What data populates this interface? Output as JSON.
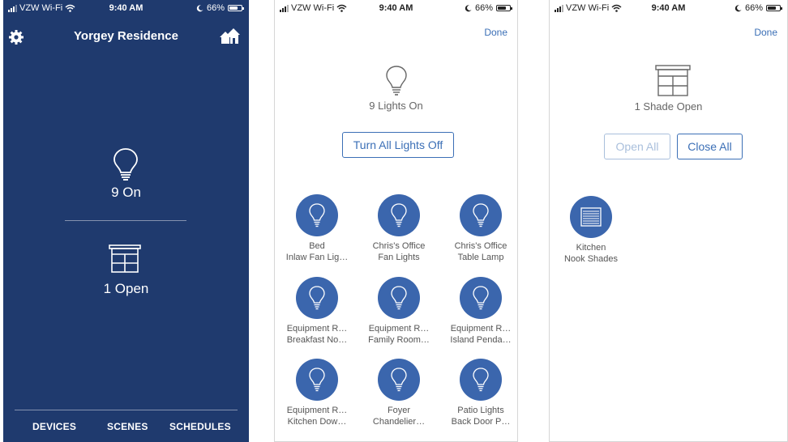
{
  "status": {
    "carrier": "VZW Wi-Fi",
    "time": "9:40 AM",
    "battery": "66%"
  },
  "home": {
    "title": "Yorgey Residence",
    "lights_summary": "9 On",
    "shades_summary": "1 Open",
    "nav": [
      "DEVICES",
      "SCENES",
      "SCHEDULES"
    ],
    "icons": {
      "settings": "gear-icon",
      "homes": "homes-icon",
      "light": "lightbulb-icon",
      "shade": "window-shade-icon"
    }
  },
  "lights": {
    "done": "Done",
    "summary": "9 Lights On",
    "turn_all_off": "Turn All Lights Off",
    "devices": [
      {
        "line1": "Bed",
        "line2": "Inlaw Fan Lig…"
      },
      {
        "line1": "Chris's Office",
        "line2": "Fan Lights"
      },
      {
        "line1": "Chris's Office",
        "line2": "Table Lamp"
      },
      {
        "line1": "Equipment R…",
        "line2": "Breakfast No…"
      },
      {
        "line1": "Equipment R…",
        "line2": "Family Room…"
      },
      {
        "line1": "Equipment R…",
        "line2": "Island Penda…"
      },
      {
        "line1": "Equipment R…",
        "line2": "Kitchen Dow…"
      },
      {
        "line1": "Foyer",
        "line2": "Chandelier…"
      },
      {
        "line1": "Patio Lights",
        "line2": "Back Door P…"
      }
    ]
  },
  "shades": {
    "done": "Done",
    "summary": "1 Shade Open",
    "open_all": "Open All",
    "close_all": "Close All",
    "devices": [
      {
        "line1": "Kitchen",
        "line2": "Nook Shades"
      }
    ]
  },
  "colors": {
    "home_bg": "#1f3a6e",
    "accent": "#3b66ad",
    "link": "#3b6fb6"
  }
}
